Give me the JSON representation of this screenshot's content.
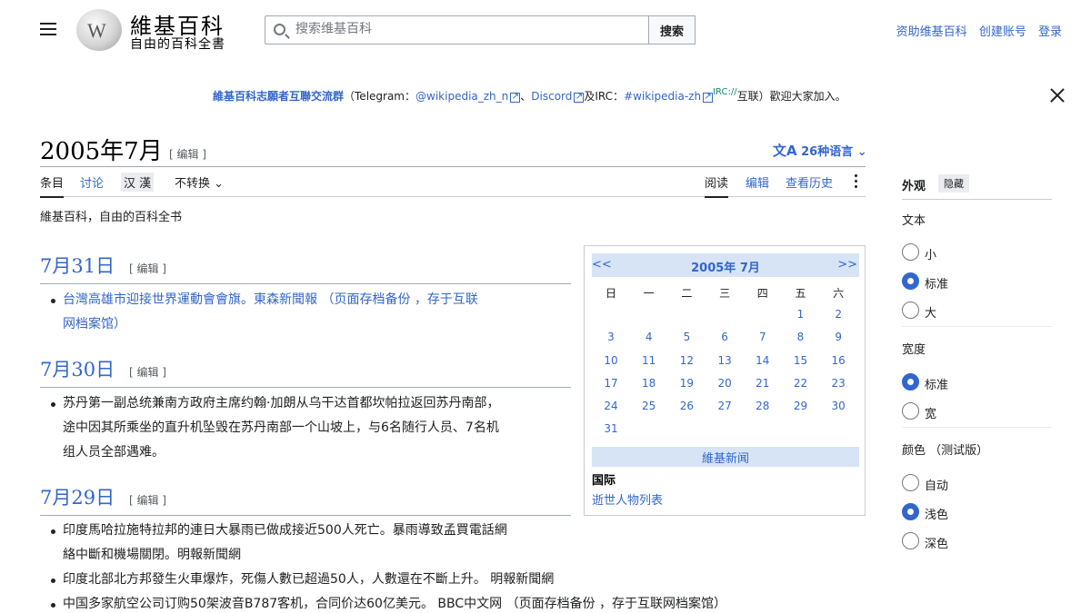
{
  "header": {
    "logo_title": "維基百科",
    "logo_subtitle": "自由的百科全書",
    "search_placeholder": "搜索维基百科",
    "search_button": "搜索",
    "user_links": [
      "资助维基百科",
      "创建账号",
      "登录"
    ]
  },
  "banner": {
    "link_title": "維基百科志願者互聯交流群",
    "prefix": "（Telegram：",
    "telegram": "@wikipedia_zh_n",
    "sep1": "、",
    "discord": "Discord",
    "and": "及IRC：",
    "irc": "#wikipedia-zh",
    "irc_sup": "IRC://",
    "suffix": "互联）歡迎大家加入。"
  },
  "page": {
    "title": "2005年7月",
    "edit_label": "[ 编辑 ]",
    "languages": "26种语言",
    "tagline": "維基百科，自由的百科全书"
  },
  "tabs": {
    "article": "条目",
    "talk": "讨论",
    "variant_simp": "汉",
    "variant_trad": "漢",
    "no_convert": "不转换",
    "read": "阅读",
    "edit": "编辑",
    "history": "查看历史"
  },
  "days": [
    {
      "heading": "7月31日",
      "edit": "[ 编辑 ]",
      "items": [
        {
          "line1": "台灣高雄市迎接世界運動會會旗。東森新聞報 （页面存档备份 ，存于互联",
          "line2": "网档案馆）"
        }
      ]
    },
    {
      "heading": "7月30日",
      "edit": "[ 编辑 ]",
      "items": [
        {
          "line1": "苏丹第一副总统兼南方政府主席约翰·加朗从乌干达首都坎帕拉返回苏丹南部，",
          "line2": "途中因其所乘坐的直升机坠毁在苏丹南部一个山坡上，与6名随行人员、7名机",
          "line3": "组人员全部遇难。"
        }
      ]
    },
    {
      "heading": "7月29日",
      "edit": "[ 编辑 ]",
      "items": [
        {
          "line1": "印度馬哈拉施特拉邦的連日大暴雨已做成接近500人死亡。暴雨導致孟買電話網",
          "line2": "絡中斷和機場關閉。明報新聞網"
        },
        {
          "line1": "印度北部北方邦發生火車爆炸，死傷人數已超過50人，人數還在不斷上升。 明報新聞網"
        },
        {
          "line1": "中国多家航空公司订购50架波音B787客机，合同价达60亿美元。 BBC中文网 （页面存档备份 ，存于互联网档案馆）"
        }
      ]
    }
  ],
  "calendar": {
    "prev": "<<",
    "next": ">>",
    "title": "2005年 7月",
    "weekdays": [
      "日",
      "一",
      "二",
      "三",
      "四",
      "五",
      "六"
    ],
    "weeks": [
      [
        "",
        "",
        "",
        "",
        "",
        "1",
        "2"
      ],
      [
        "3",
        "4",
        "5",
        "6",
        "7",
        "8",
        "9"
      ],
      [
        "10",
        "11",
        "12",
        "13",
        "14",
        "15",
        "16"
      ],
      [
        "17",
        "18",
        "19",
        "20",
        "21",
        "22",
        "23"
      ],
      [
        "24",
        "25",
        "26",
        "27",
        "28",
        "29",
        "30"
      ],
      [
        "31",
        "",
        "",
        "",
        "",
        "",
        ""
      ]
    ],
    "news_label": "維基新闻",
    "section": "国际",
    "section_link": "逝世人物列表"
  },
  "appearance": {
    "title": "外观",
    "hide": "隐藏",
    "text_group": "文本",
    "text_options": [
      "小",
      "标准",
      "大"
    ],
    "text_selected": "标准",
    "width_group": "宽度",
    "width_options": [
      "标准",
      "宽"
    ],
    "width_selected": "标准",
    "color_group": "颜色 （测试版）",
    "color_options": [
      "自动",
      "浅色",
      "深色"
    ],
    "color_selected": "浅色"
  },
  "colors": {
    "link": "#3366cc",
    "text": "#202122",
    "calendar_header": "#d6e4f5"
  }
}
